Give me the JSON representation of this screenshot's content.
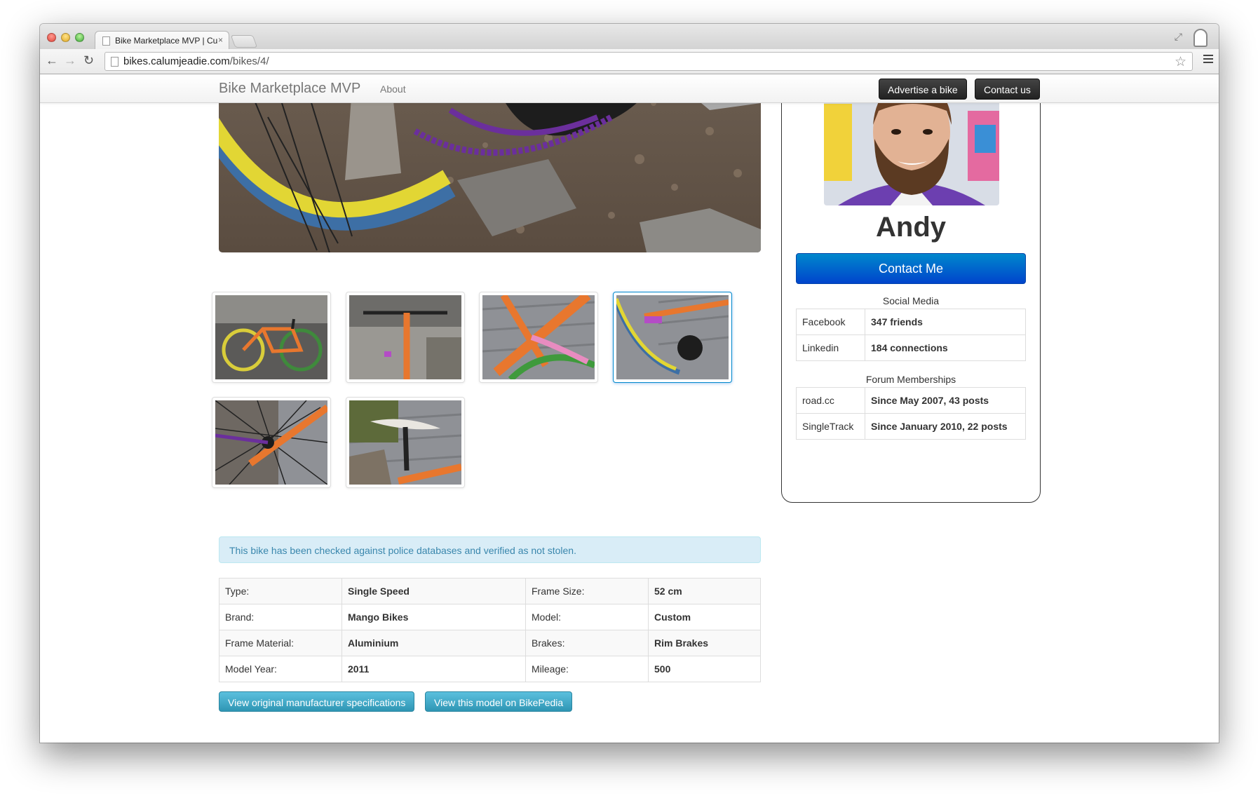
{
  "browser": {
    "tab_title": "Bike Marketplace MVP | Cu",
    "tab_close": "×",
    "url_host": "bikes.calumjeadie.com",
    "url_path": "/bikes/4/",
    "back_icon": "←",
    "forward_icon": "→",
    "reload_icon": "↻",
    "star_icon": "☆",
    "fullscreen_icon": "⤢"
  },
  "navbar": {
    "brand": "Bike Marketplace MVP",
    "about": "About",
    "advertise": "Advertise a bike",
    "contact": "Contact us"
  },
  "gallery": {
    "thumbnails": [
      {
        "label": "orange bike side view"
      },
      {
        "label": "orange bike front view"
      },
      {
        "label": "orange frame close-up"
      },
      {
        "label": "crankset and chain close-up"
      },
      {
        "label": "rear hub close-up"
      },
      {
        "label": "saddle close-up"
      }
    ],
    "selected_index": 3
  },
  "alert": {
    "text": "This bike has been checked against police databases and verified as not stolen."
  },
  "specs": {
    "rows": [
      {
        "k1": "Type:",
        "v1": "Single Speed",
        "k2": "Frame Size:",
        "v2": "52 cm"
      },
      {
        "k1": "Brand:",
        "v1": "Mango Bikes",
        "k2": "Model:",
        "v2": "Custom"
      },
      {
        "k1": "Frame Material:",
        "v1": "Aluminium",
        "k2": "Brakes:",
        "v2": "Rim Brakes"
      },
      {
        "k1": "Model Year:",
        "v1": "2011",
        "k2": "Mileage:",
        "v2": "500"
      }
    ]
  },
  "buttons": {
    "manufacturer": "View original manufacturer specifications",
    "bikepedia": "View this model on BikePedia"
  },
  "seller": {
    "name": "Andy",
    "contact_button": "Contact Me",
    "social_caption": "Social Media",
    "social": [
      {
        "k": "Facebook",
        "v": "347 friends"
      },
      {
        "k": "Linkedin",
        "v": "184 connections"
      }
    ],
    "forum_caption": "Forum Memberships",
    "forums": [
      {
        "k": "road.cc",
        "v": "Since May 2007, 43 posts"
      },
      {
        "k": "SingleTrack",
        "v": "Since January 2010, 22 posts"
      }
    ]
  },
  "colors": {
    "primary_button": "#0066cc",
    "info_button": "#49afcd",
    "alert_bg": "#d9edf7",
    "navbar_button": "#333333"
  }
}
